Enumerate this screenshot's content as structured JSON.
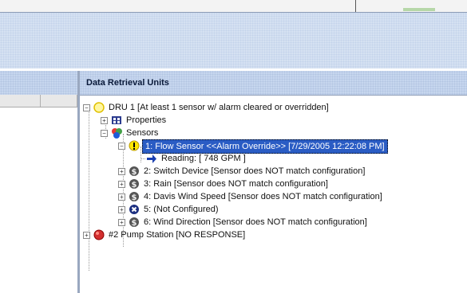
{
  "panel": {
    "title": "Data Retrieval Units"
  },
  "tree": {
    "dru1": {
      "label": "DRU 1  [At least 1 sensor w/ alarm cleared or overridden]"
    },
    "properties": {
      "label": "Properties"
    },
    "sensors": {
      "label": "Sensors"
    },
    "items": [
      {
        "label": "1: Flow Sensor  <<Alarm Override>> [7/29/2005 12:22:08 PM]",
        "icon": "alarm-exclamation-icon"
      },
      {
        "label": "Reading: [ 748 GPM ]",
        "icon": "arrow-right-icon"
      },
      {
        "label": "2: Switch Device  [Sensor does NOT match configuration]",
        "icon": "mismatch-icon"
      },
      {
        "label": "3: Rain  [Sensor does NOT match configuration]",
        "icon": "mismatch-icon"
      },
      {
        "label": "4: Davis Wind Speed  [Sensor does NOT match configuration]",
        "icon": "mismatch-icon"
      },
      {
        "label": "5: (Not Configured)",
        "icon": "not-configured-icon"
      },
      {
        "label": "6: Wind Direction  [Sensor does NOT match configuration]",
        "icon": "mismatch-icon"
      }
    ],
    "pump": {
      "label": "#2 Pump Station  [NO RESPONSE]"
    }
  }
}
